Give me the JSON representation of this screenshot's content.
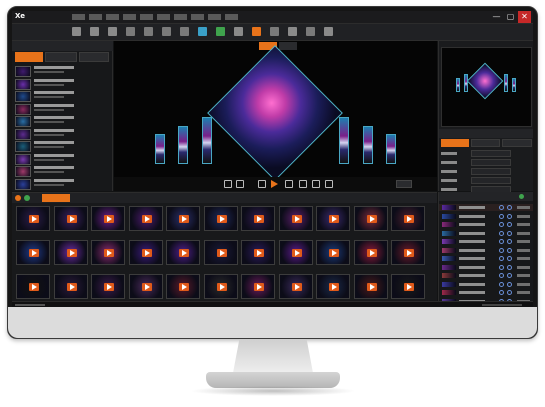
{
  "app": {
    "title": "",
    "logo_text": "Xe",
    "accent": "#e8731a",
    "menu_items": [
      "",
      "",
      "",
      "",
      "",
      "",
      "",
      "",
      "",
      ""
    ],
    "window_controls": [
      "—",
      "▢",
      "✕"
    ],
    "close_color": "#c62828"
  },
  "toolbar": {
    "icons": [
      "new-icon",
      "open-icon",
      "save-icon",
      "import-icon",
      "export-icon",
      "undo-icon",
      "redo-icon",
      "grid-icon",
      "layout-icon",
      "mapping-icon",
      "settings-icon",
      "screen-icon",
      "output-icon",
      "record-icon",
      "fullscreen-icon"
    ]
  },
  "sidebar": {
    "header": "",
    "tabs": [
      "",
      "",
      ""
    ],
    "items": [
      {
        "name": "",
        "sub": "",
        "thumb": "#3f1b6e"
      },
      {
        "name": "",
        "sub": "",
        "thumb": "#6a2eaa"
      },
      {
        "name": "",
        "sub": "",
        "thumb": "#1f4a8c"
      },
      {
        "name": "",
        "sub": "",
        "thumb": "#8a2a5e"
      },
      {
        "name": "",
        "sub": "",
        "thumb": "#2a6fa6"
      },
      {
        "name": "",
        "sub": "",
        "thumb": "#5d2b8f"
      },
      {
        "name": "",
        "sub": "",
        "thumb": "#1a5e7a"
      },
      {
        "name": "",
        "sub": "",
        "thumb": "#7a3ab0"
      },
      {
        "name": "",
        "sub": "",
        "thumb": "#a03a6a"
      },
      {
        "name": "",
        "sub": "",
        "thumb": "#2a3f9a"
      }
    ]
  },
  "stage": {
    "tabs": [
      "",
      ""
    ],
    "controls": [
      "prev-icon",
      "next-icon",
      "pause-icon",
      "play-icon",
      "stop-icon",
      "volume-icon",
      "output-icon",
      "screen-icon"
    ],
    "zoom": ""
  },
  "properties": {
    "tabs": [
      "",
      "",
      ""
    ],
    "rows": [
      {
        "label": "",
        "value": ""
      },
      {
        "label": "",
        "value": ""
      },
      {
        "label": "",
        "value": ""
      },
      {
        "label": "",
        "value": ""
      },
      {
        "label": "",
        "value": ""
      },
      {
        "label": "",
        "value": ""
      }
    ]
  },
  "bottom_panel": {
    "tabs": [
      ""
    ],
    "clips": [
      {
        "name": "",
        "color": "#2b1d4a"
      },
      {
        "name": "",
        "color": "#3a1f5e"
      },
      {
        "name": "",
        "color": "#6a1c86"
      },
      {
        "name": "",
        "color": "#4c1a6e"
      },
      {
        "name": "",
        "color": "#2a2f6a"
      },
      {
        "name": "",
        "color": "#1e2a5a"
      },
      {
        "name": "",
        "color": "#2f1a4e"
      },
      {
        "name": "",
        "color": "#5a1e6a"
      },
      {
        "name": "",
        "color": "#3a2a6e"
      },
      {
        "name": "",
        "color": "#7a2a3a"
      },
      {
        "name": "",
        "color": "#4a1e2e"
      },
      {
        "name": "",
        "color": "#1e3a8a"
      },
      {
        "name": "",
        "color": "#6a2aa0"
      },
      {
        "name": "",
        "color": "#8a2a6e"
      },
      {
        "name": "",
        "color": "#3a1a7a"
      },
      {
        "name": "",
        "color": "#4e1e8a"
      },
      {
        "name": "",
        "color": "#1a1a3a"
      },
      {
        "name": "",
        "color": "#2a1a5a"
      },
      {
        "name": "",
        "color": "#5a1a8a"
      },
      {
        "name": "",
        "color": "#1a3a7a"
      },
      {
        "name": "",
        "color": "#8a1a3a"
      },
      {
        "name": "",
        "color": "#6a1a2a"
      },
      {
        "name": "",
        "color": "#121212"
      },
      {
        "name": "",
        "color": "#2a1a3a"
      },
      {
        "name": "",
        "color": "#3a1a4a"
      },
      {
        "name": "",
        "color": "#4a2a5a"
      },
      {
        "name": "",
        "color": "#5a1a2a"
      },
      {
        "name": "",
        "color": "#2a2a2a"
      },
      {
        "name": "",
        "color": "#6a1a5a"
      },
      {
        "name": "",
        "color": "#3a2a5a"
      },
      {
        "name": "",
        "color": "#1a2a4a"
      },
      {
        "name": "",
        "color": "#4a1a1a"
      },
      {
        "name": "",
        "color": "#1a1a1a"
      }
    ]
  },
  "layers": {
    "header": "",
    "items": [
      {
        "name": "",
        "value": "",
        "color": "#5a2aa0"
      },
      {
        "name": "",
        "value": "",
        "color": "#2a4aa0"
      },
      {
        "name": "",
        "value": "",
        "color": "#8a2a7a"
      },
      {
        "name": "",
        "value": "",
        "color": "#2a6aa0"
      },
      {
        "name": "",
        "value": "",
        "color": "#7a3ab0"
      },
      {
        "name": "",
        "value": "",
        "color": "#a03a6a"
      },
      {
        "name": "",
        "value": "",
        "color": "#3a5ab0"
      },
      {
        "name": "",
        "value": "",
        "color": "#6a2a8a"
      },
      {
        "name": "",
        "value": "",
        "color": "#8a3a3a"
      },
      {
        "name": "",
        "value": "",
        "color": "#3a3aa0"
      },
      {
        "name": "",
        "value": "",
        "color": "#a02a4a"
      },
      {
        "name": "",
        "value": "",
        "color": "#5a3a9a"
      }
    ]
  },
  "status": {
    "left": "",
    "right": ""
  }
}
